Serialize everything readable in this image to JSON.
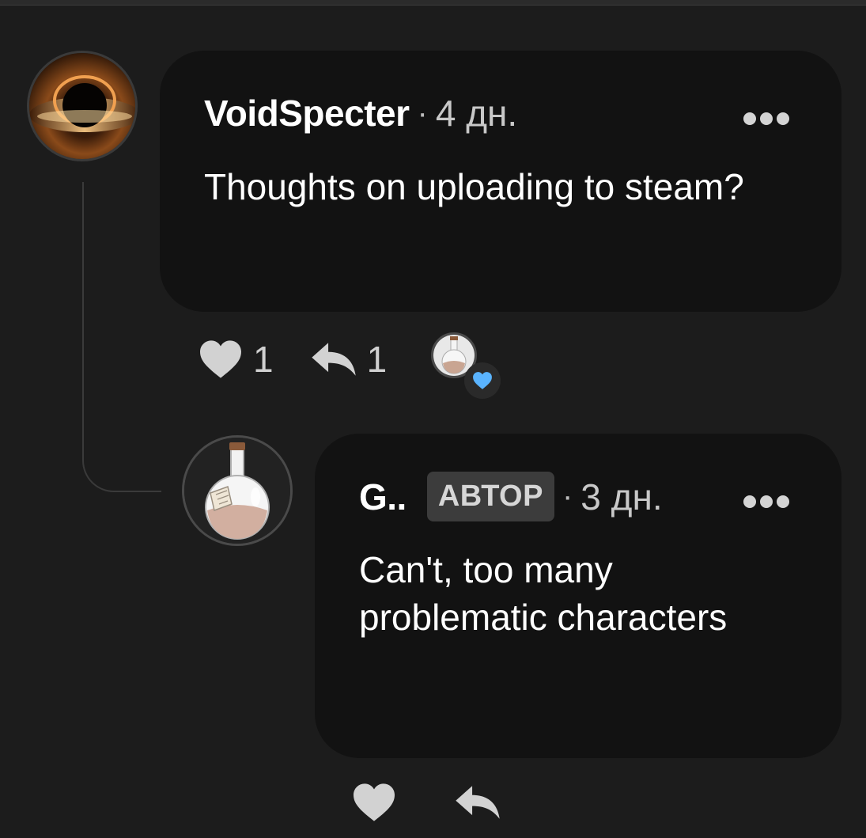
{
  "comments": [
    {
      "author": "VoidSpecter",
      "separator": "·",
      "time": "4 дн.",
      "text": "Thoughts on uploading to steam?",
      "likes": "1",
      "replies": "1"
    },
    {
      "author": "G..",
      "badge": "АВТОР",
      "separator": "·",
      "time": "3 дн.",
      "text": "Can't, too many problematic characters"
    }
  ],
  "icons": {
    "like": "heart-icon",
    "reply": "reply-arrow-icon",
    "more": "more-dots-icon",
    "reaction": "heart-reaction-icon"
  },
  "colors": {
    "background": "#1c1c1c",
    "bubble": "#121212",
    "reaction_heart": "#5ab4ff",
    "badge_bg": "#3c3c3c"
  }
}
